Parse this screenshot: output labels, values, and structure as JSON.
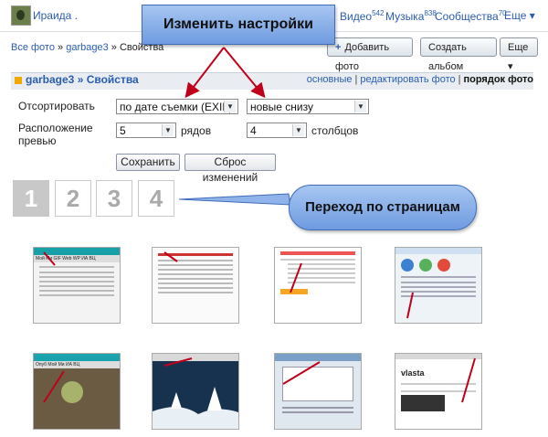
{
  "topbar": {
    "username": "Ираида .",
    "nav": [
      {
        "label": "Видео",
        "count": "542"
      },
      {
        "label": "Музыка",
        "count": "838"
      },
      {
        "label": "Сообщества",
        "count": "70"
      }
    ],
    "more_label": "Еще ▾"
  },
  "breadcrumb": {
    "all_photos": "Все фото",
    "sep": "»",
    "album": "garbage3",
    "current": "Свойства"
  },
  "buttons": {
    "add_photo": "Добавить фото",
    "create_album": "Создать альбом",
    "more": "Еще ▾"
  },
  "album": {
    "title": "garbage3 » Свойства",
    "links": {
      "basic": "основные",
      "edit_photos": "редактировать фото",
      "photo_order": "порядок фото",
      "sep": "|"
    }
  },
  "form": {
    "sort_label": "Отсортировать",
    "sort_by": "по дате съемки (EXIF)",
    "sort_order": "новые снизу",
    "layout_label_1": "Расположение",
    "layout_label_2": "превью",
    "rows_value": "5",
    "rows_label": "рядов",
    "cols_value": "4",
    "cols_label": "столбцов",
    "save": "Сохранить",
    "reset": "Сброс изменений"
  },
  "pages": [
    "1",
    "2",
    "3",
    "4"
  ],
  "callouts": {
    "settings": "Изменить настройки",
    "paging": "Переход по страницам"
  },
  "colors": {
    "link": "#2a5db0",
    "callout": "#8fb3ea",
    "arrow": "#c0001a"
  },
  "thumbnails": [
    {
      "kind": "text-window",
      "tab_labels": [
        "Мой Ми",
        "GIF Web",
        "WP",
        "ИА",
        "ВЦ"
      ]
    },
    {
      "kind": "text-page"
    },
    {
      "kind": "list-page"
    },
    {
      "kind": "settings-window"
    },
    {
      "kind": "desktop-window",
      "tab_labels": [
        "Опуб",
        "Мой Ми",
        "ИА",
        "ВЦ"
      ]
    },
    {
      "kind": "winter-window"
    },
    {
      "kind": "file-window"
    },
    {
      "kind": "profile-page",
      "name_text": "vlasta"
    }
  ]
}
